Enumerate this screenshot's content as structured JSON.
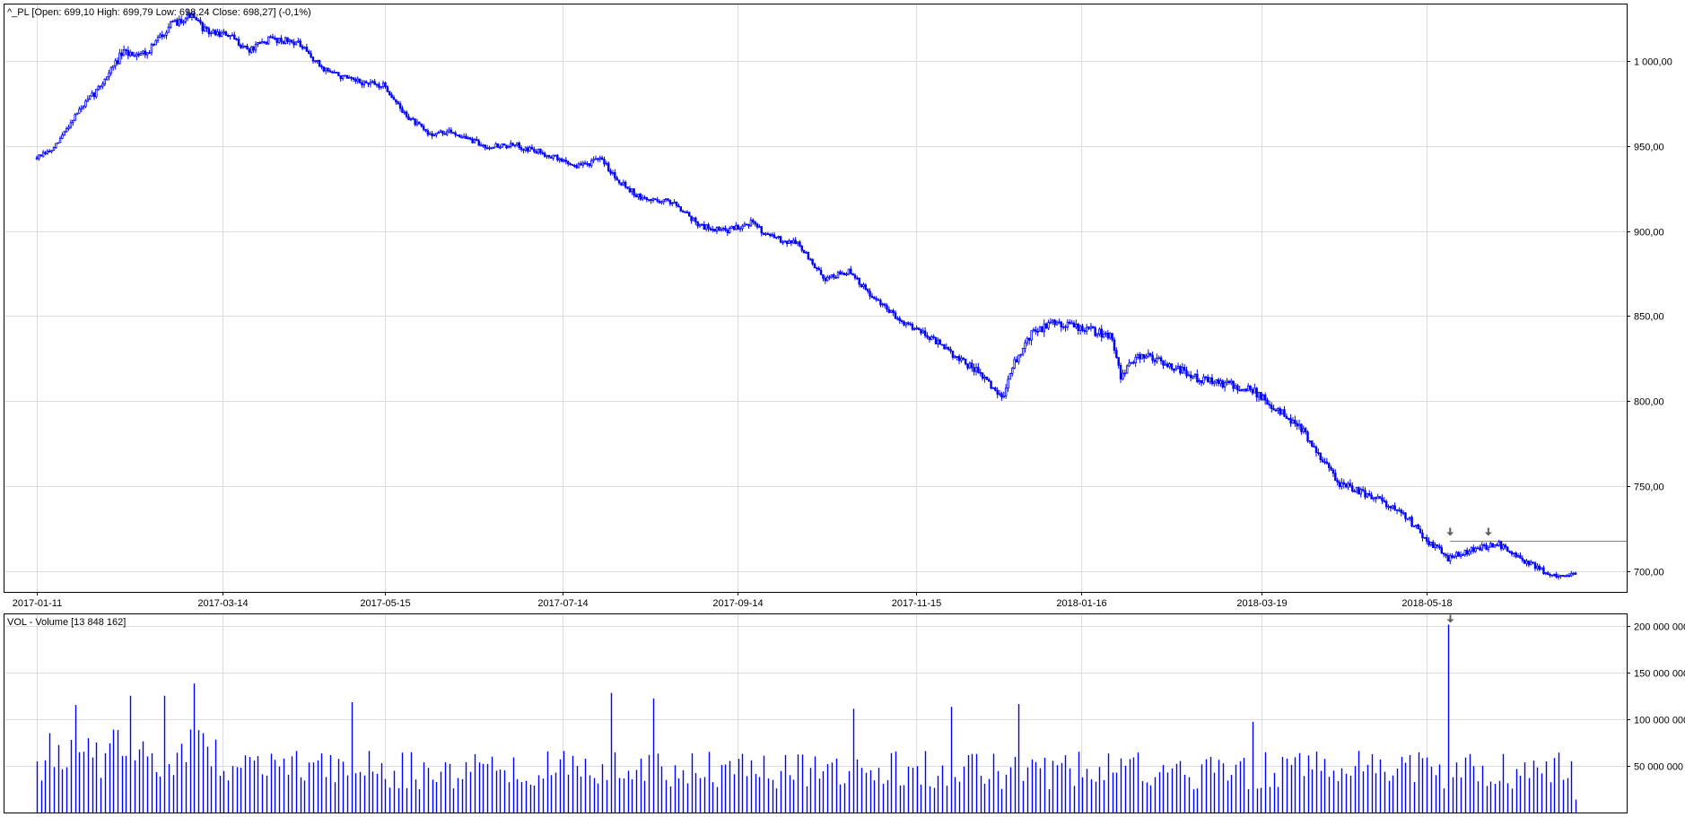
{
  "chart_data": [
    {
      "type": "candlestick",
      "legend": "^_PL [Open: 699,10  High: 699,79  Low: 698,24  Close: 698,27] (-0,1%)",
      "x_ticks": [
        "2017-01-11",
        "2017-03-14",
        "2017-05-15",
        "2017-07-14",
        "2017-09-14",
        "2017-11-15",
        "2018-01-16",
        "2018-03-19",
        "2018-05-18"
      ],
      "y_ticks": [
        "700,00",
        "750,00",
        "800,00",
        "850,00",
        "900,00",
        "950,00",
        "1 000,00"
      ],
      "ylim": [
        688,
        1033
      ],
      "grid": true,
      "trend_points": [
        [
          0,
          943
        ],
        [
          8,
          948
        ],
        [
          18,
          968
        ],
        [
          28,
          982
        ],
        [
          40,
          1004
        ],
        [
          52,
          1005
        ],
        [
          62,
          1020
        ],
        [
          72,
          1027
        ],
        [
          80,
          1017
        ],
        [
          90,
          1015
        ],
        [
          100,
          1006
        ],
        [
          110,
          1013
        ],
        [
          122,
          1011
        ],
        [
          134,
          996
        ],
        [
          148,
          988
        ],
        [
          164,
          985
        ],
        [
          172,
          970
        ],
        [
          184,
          957
        ],
        [
          196,
          958
        ],
        [
          210,
          950
        ],
        [
          226,
          950
        ],
        [
          240,
          945
        ],
        [
          254,
          938
        ],
        [
          266,
          942
        ],
        [
          272,
          932
        ],
        [
          284,
          919
        ],
        [
          300,
          917
        ],
        [
          312,
          903
        ],
        [
          324,
          900
        ],
        [
          336,
          905
        ],
        [
          346,
          896
        ],
        [
          358,
          893
        ],
        [
          370,
          872
        ],
        [
          382,
          876
        ],
        [
          394,
          860
        ],
        [
          406,
          848
        ],
        [
          418,
          840
        ],
        [
          430,
          828
        ],
        [
          442,
          818
        ],
        [
          454,
          802
        ],
        [
          460,
          822
        ],
        [
          468,
          840
        ],
        [
          480,
          847
        ],
        [
          492,
          843
        ],
        [
          506,
          838
        ],
        [
          510,
          815
        ],
        [
          520,
          828
        ],
        [
          532,
          822
        ],
        [
          546,
          813
        ],
        [
          560,
          810
        ],
        [
          572,
          806
        ],
        [
          584,
          795
        ],
        [
          594,
          785
        ],
        [
          602,
          772
        ],
        [
          612,
          752
        ],
        [
          626,
          745
        ],
        [
          642,
          736
        ],
        [
          654,
          718
        ],
        [
          664,
          708
        ],
        [
          676,
          713
        ],
        [
          688,
          716
        ],
        [
          700,
          706
        ],
        [
          712,
          698
        ],
        [
          724,
          698
        ]
      ],
      "volatility": [
        [
          0,
          1.5
        ],
        [
          40,
          3.0
        ],
        [
          80,
          2.5
        ],
        [
          130,
          2.4
        ],
        [
          200,
          2.0
        ],
        [
          300,
          2.2
        ],
        [
          400,
          2.2
        ],
        [
          450,
          3.0
        ],
        [
          470,
          3.6
        ],
        [
          520,
          3.0
        ],
        [
          600,
          3.2
        ],
        [
          640,
          2.6
        ],
        [
          700,
          2.2
        ],
        [
          724,
          1.5
        ]
      ],
      "bar_count": 725,
      "seed": 7,
      "last_bar": {
        "open": 699.1,
        "high": 699.79,
        "low": 698.24,
        "close": 698.27
      },
      "reference_line": {
        "value": 718,
        "from_index": 665
      },
      "markers": [
        {
          "index": 665,
          "value": 722
        },
        {
          "index": 683,
          "value": 722
        }
      ],
      "colors": {
        "up": "#0000ff",
        "down": "#0000ff",
        "fill_up": "#ffffff",
        "grid": "#dcdcdc",
        "reference_line": "#808080",
        "marker": "#606060"
      }
    },
    {
      "type": "bar",
      "legend": "VOL - Volume [13 848 162]",
      "y_ticks": [
        "50 000 000",
        "100 000 000",
        "150 000 000",
        "200 000 000"
      ],
      "ylim": [
        0,
        212000000
      ],
      "grid": true,
      "base_volume": 55000000,
      "spikes": [
        {
          "index": 18,
          "value": 115000000
        },
        {
          "index": 44,
          "value": 125000000
        },
        {
          "index": 60,
          "value": 125000000
        },
        {
          "index": 74,
          "value": 138000000
        },
        {
          "index": 148,
          "value": 118000000
        },
        {
          "index": 270,
          "value": 128000000
        },
        {
          "index": 290,
          "value": 122000000
        },
        {
          "index": 384,
          "value": 111000000
        },
        {
          "index": 430,
          "value": 113000000
        },
        {
          "index": 462,
          "value": 116000000
        },
        {
          "index": 572,
          "value": 97000000
        },
        {
          "index": 665,
          "value": 201000000
        }
      ],
      "last_value": 13848162,
      "markers": [
        {
          "index": 665
        }
      ],
      "colors": {
        "bar": "#0000ff",
        "grid": "#dcdcdc",
        "marker": "#606060"
      }
    }
  ]
}
